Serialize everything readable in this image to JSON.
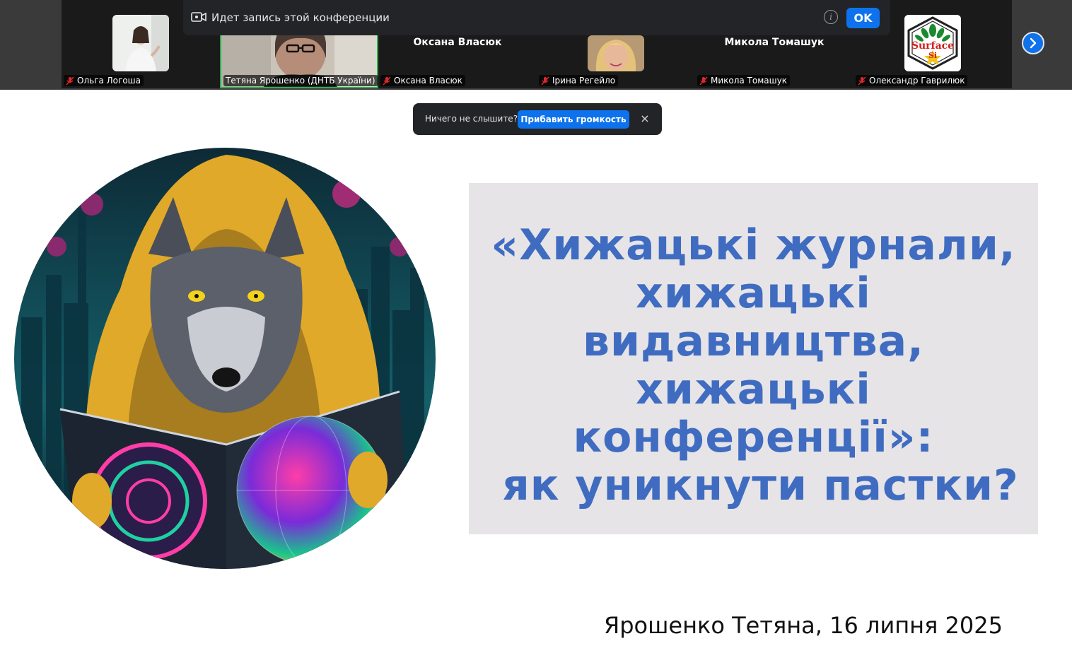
{
  "recording_banner": {
    "text": "Идет запись этой конференции",
    "ok_label": "OK",
    "info_glyph": "i"
  },
  "participants": [
    {
      "name": "Ольга Логоша",
      "display": "video-thumb",
      "muted": true
    },
    {
      "name": "Тетяна Ярошенко (ДНТБ України)",
      "display": "video-thumb",
      "muted": false,
      "active_speaker": true
    },
    {
      "name": "Оксана Власюк",
      "display": "name-only",
      "big_name": "Оксана Власюк",
      "muted": true
    },
    {
      "name": "Ірина Регейло",
      "display": "video-thumb",
      "muted": true
    },
    {
      "name": "Микола Томашук",
      "display": "name-only",
      "big_name": "Микола Томашук",
      "muted": true
    },
    {
      "name": "Олександр Гаврилюк",
      "display": "logo-thumb",
      "logo_text_1": "Surface",
      "logo_text_2": "Si",
      "muted": true
    }
  ],
  "audio_toast": {
    "message": "Ничего не слышите?",
    "button": "Прибавить громкость",
    "close": "×"
  },
  "slide": {
    "title_lines": [
      "«Хижацькі журнали,",
      "хижацькі",
      "видавництва,",
      "хижацькі",
      "конференції»:",
      "як уникнути пастки?"
    ],
    "author_line": "Ярошенко Тетяна, 16 липня 2025"
  },
  "colors": {
    "title_blue": "#3f6cc1",
    "zoom_blue": "#0e72ed",
    "title_box_bg": "#e6e4e6",
    "active_speaker_green": "#2bb24c",
    "mute_red": "#e02828"
  },
  "icons": {
    "mute": "mic-muted-icon",
    "next": "chevron-right-icon",
    "recording": "recording-camera-icon",
    "info": "info-icon",
    "close": "close-icon"
  }
}
